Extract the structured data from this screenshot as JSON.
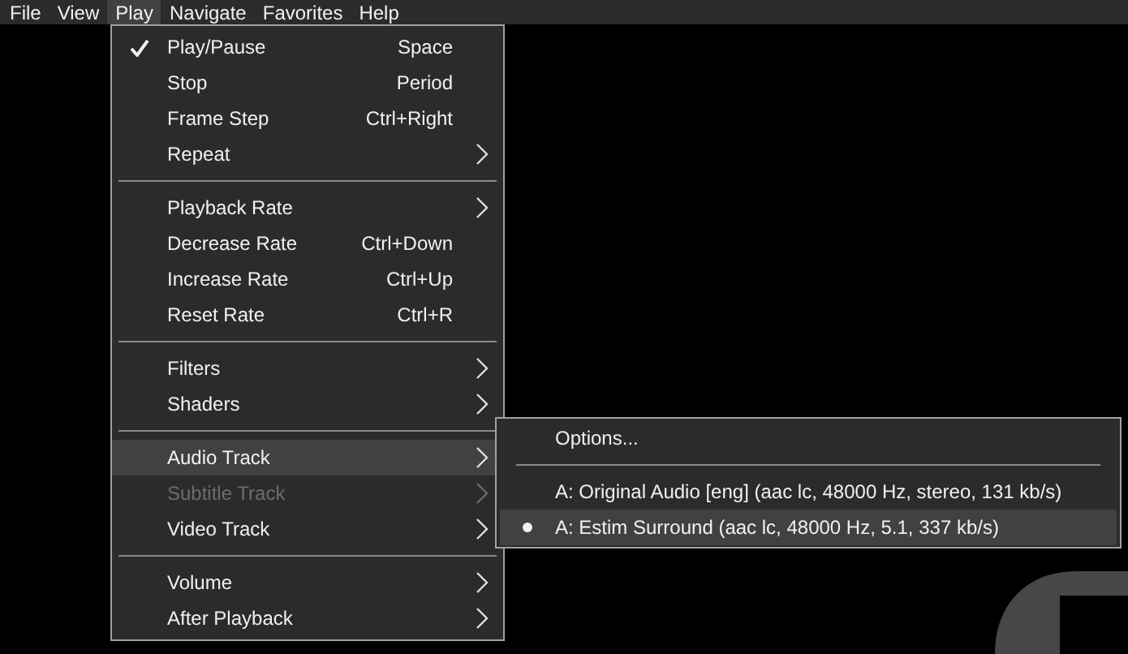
{
  "menubar": [
    {
      "label": "File",
      "selected": false
    },
    {
      "label": "View",
      "selected": false
    },
    {
      "label": "Play",
      "selected": true
    },
    {
      "label": "Navigate",
      "selected": false
    },
    {
      "label": "Favorites",
      "selected": false
    },
    {
      "label": "Help",
      "selected": false
    }
  ],
  "play_menu": [
    {
      "kind": "item",
      "label": "Play/Pause",
      "shortcut": "Space",
      "checked": true,
      "disabled": false,
      "highlighted": false,
      "submenu": false
    },
    {
      "kind": "item",
      "label": "Stop",
      "shortcut": "Period",
      "checked": false,
      "disabled": false,
      "highlighted": false,
      "submenu": false
    },
    {
      "kind": "item",
      "label": "Frame Step",
      "shortcut": "Ctrl+Right",
      "checked": false,
      "disabled": false,
      "highlighted": false,
      "submenu": false
    },
    {
      "kind": "item",
      "label": "Repeat",
      "checked": false,
      "disabled": false,
      "highlighted": false,
      "submenu": true
    },
    {
      "kind": "separator"
    },
    {
      "kind": "item",
      "label": "Playback Rate",
      "checked": false,
      "disabled": false,
      "highlighted": false,
      "submenu": true
    },
    {
      "kind": "item",
      "label": "Decrease Rate",
      "shortcut": "Ctrl+Down",
      "checked": false,
      "disabled": false,
      "highlighted": false,
      "submenu": false
    },
    {
      "kind": "item",
      "label": "Increase Rate",
      "shortcut": "Ctrl+Up",
      "checked": false,
      "disabled": false,
      "highlighted": false,
      "submenu": false
    },
    {
      "kind": "item",
      "label": "Reset Rate",
      "shortcut": "Ctrl+R",
      "checked": false,
      "disabled": false,
      "highlighted": false,
      "submenu": false
    },
    {
      "kind": "separator"
    },
    {
      "kind": "item",
      "label": "Filters",
      "checked": false,
      "disabled": false,
      "highlighted": false,
      "submenu": true
    },
    {
      "kind": "item",
      "label": "Shaders",
      "checked": false,
      "disabled": false,
      "highlighted": false,
      "submenu": true
    },
    {
      "kind": "separator"
    },
    {
      "kind": "item",
      "label": "Audio Track",
      "checked": false,
      "disabled": false,
      "highlighted": true,
      "submenu": true
    },
    {
      "kind": "item",
      "label": "Subtitle Track",
      "checked": false,
      "disabled": true,
      "highlighted": false,
      "submenu": true
    },
    {
      "kind": "item",
      "label": "Video Track",
      "checked": false,
      "disabled": false,
      "highlighted": false,
      "submenu": true
    },
    {
      "kind": "separator"
    },
    {
      "kind": "item",
      "label": "Volume",
      "checked": false,
      "disabled": false,
      "highlighted": false,
      "submenu": true
    },
    {
      "kind": "item",
      "label": "After Playback",
      "checked": false,
      "disabled": false,
      "highlighted": false,
      "submenu": true
    }
  ],
  "audio_track_menu": [
    {
      "kind": "item",
      "label": "Options...",
      "checked": false,
      "highlighted": false
    },
    {
      "kind": "separator"
    },
    {
      "kind": "item",
      "label": "A: Original Audio [eng] (aac lc, 48000 Hz, stereo, 131 kb/s)",
      "checked": false,
      "highlighted": false
    },
    {
      "kind": "item",
      "label": "A: Estim Surround (aac lc, 48000 Hz, 5.1, 337 kb/s)",
      "checked": true,
      "highlighted": true
    }
  ]
}
